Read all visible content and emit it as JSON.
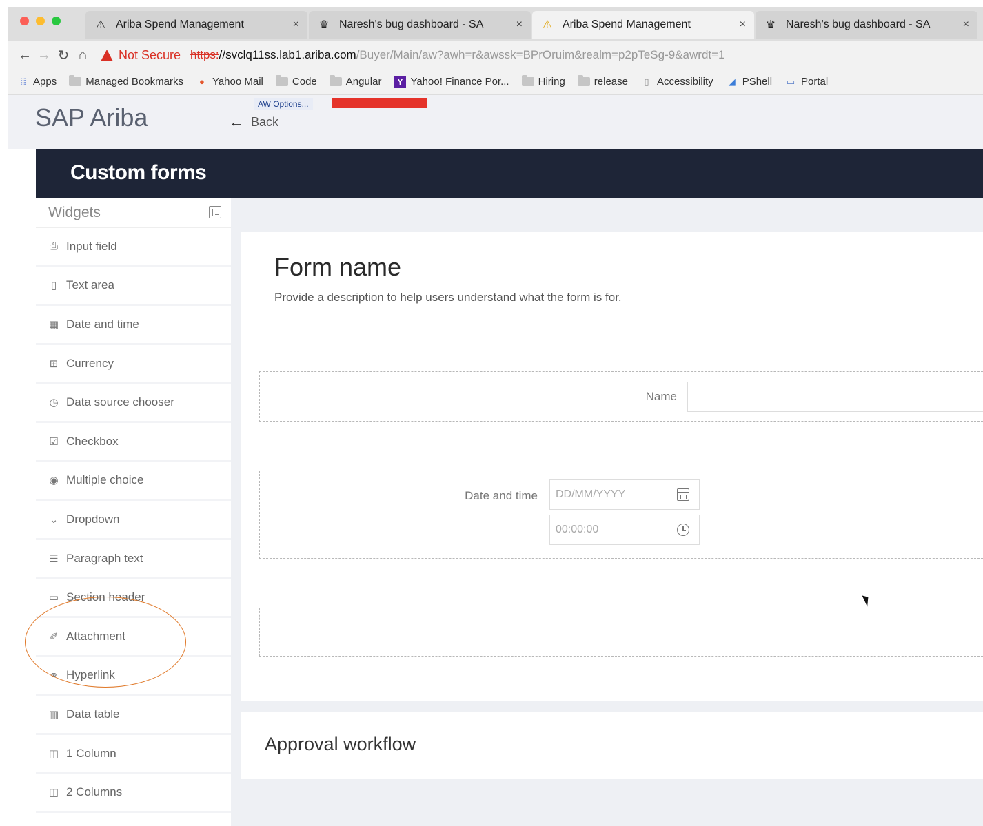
{
  "browser": {
    "tabs": [
      {
        "title": "Ariba Spend Management",
        "active": false,
        "favicon": "ariba-warning-icon"
      },
      {
        "title": "Naresh's bug dashboard - SA",
        "active": false,
        "favicon": "bug-dashboard-icon"
      },
      {
        "title": "Ariba Spend Management",
        "active": true,
        "favicon": "ariba-warning-icon"
      },
      {
        "title": "Naresh's bug dashboard - SA",
        "active": false,
        "favicon": "bug-dashboard-icon"
      }
    ],
    "tab_close": "×",
    "security_label": "Not Secure",
    "url": {
      "scheme": "https:",
      "host": "//svclq11ss.lab1.ariba.com",
      "path": "/Buyer/Main/aw?awh=r&awssk=BPrOruim&realm=p2pTeSg-9&awrdt=1"
    },
    "bookmarks": [
      {
        "label": "Apps",
        "icon": "apps-grid-icon"
      },
      {
        "label": "Managed Bookmarks",
        "icon": "folder-icon"
      },
      {
        "label": "Yahoo Mail",
        "icon": "yahoo-mail-icon"
      },
      {
        "label": "Code",
        "icon": "folder-icon"
      },
      {
        "label": "Angular",
        "icon": "folder-icon"
      },
      {
        "label": "Yahoo! Finance Por...",
        "icon": "yahoo-icon"
      },
      {
        "label": "Hiring",
        "icon": "folder-icon"
      },
      {
        "label": "release",
        "icon": "folder-icon"
      },
      {
        "label": "Accessibility",
        "icon": "page-icon"
      },
      {
        "label": "PShell",
        "icon": "pshell-icon"
      },
      {
        "label": "Portal",
        "icon": "portal-icon"
      }
    ]
  },
  "app": {
    "brand": "SAP Ariba",
    "aw_options": "AW Options...",
    "back_label": "Back",
    "page_title": "Custom forms"
  },
  "sidebar": {
    "header": "Widgets",
    "items": [
      {
        "label": "Input field",
        "icon": "input-field-icon"
      },
      {
        "label": "Text area",
        "icon": "text-area-icon"
      },
      {
        "label": "Date and time",
        "icon": "calendar-icon"
      },
      {
        "label": "Currency",
        "icon": "currency-icon"
      },
      {
        "label": "Data source chooser",
        "icon": "data-source-icon"
      },
      {
        "label": "Checkbox",
        "icon": "checkbox-icon"
      },
      {
        "label": "Multiple choice",
        "icon": "radio-icon"
      },
      {
        "label": "Dropdown",
        "icon": "dropdown-icon"
      },
      {
        "label": "Paragraph text",
        "icon": "paragraph-icon"
      },
      {
        "label": "Section header",
        "icon": "section-header-icon"
      },
      {
        "label": "Attachment",
        "icon": "paperclip-icon"
      },
      {
        "label": "Hyperlink",
        "icon": "link-icon"
      },
      {
        "label": "Data table",
        "icon": "table-icon"
      },
      {
        "label": "1 Column",
        "icon": "one-column-icon"
      },
      {
        "label": "2 Columns",
        "icon": "two-columns-icon"
      }
    ]
  },
  "form": {
    "title": "Form name",
    "description": "Provide a description to help users understand what the form is for.",
    "name_label": "Name",
    "name_value": "",
    "datetime_label": "Date and time",
    "date_placeholder": "DD/MM/YYYY",
    "time_placeholder": "00:00:00"
  },
  "approval": {
    "title": "Approval workflow"
  },
  "colors": {
    "title_bar": "#1e2537",
    "annotation": "#e07a2b",
    "not_secure": "#d93025"
  }
}
